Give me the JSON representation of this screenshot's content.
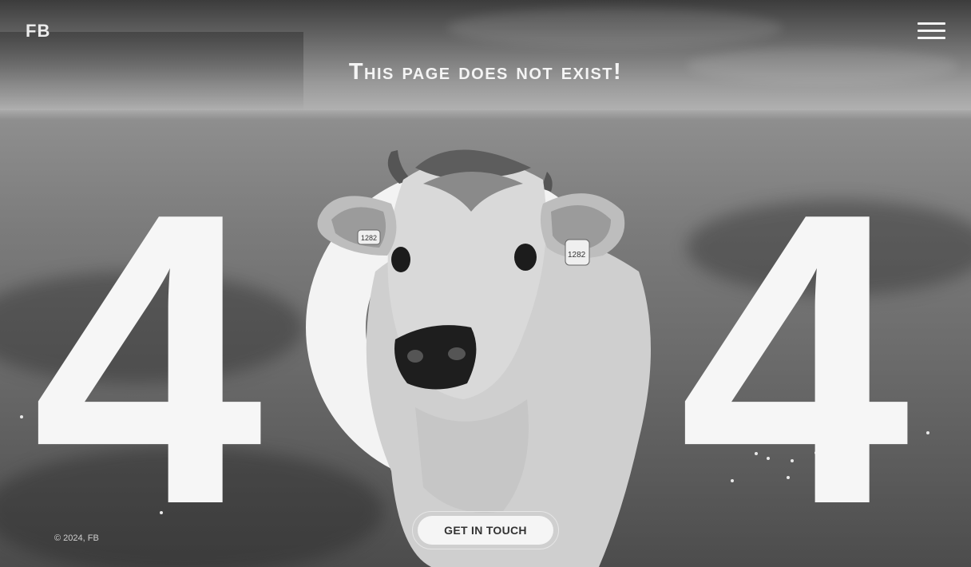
{
  "header": {
    "logo": "FB",
    "menu_icon": "hamburger-menu-icon"
  },
  "headline": "This page does not exist!",
  "error_code": {
    "digit_left": "4",
    "digit_middle": "0",
    "digit_right": "4"
  },
  "cta": {
    "label": "GET IN TOUCH"
  },
  "footer": {
    "copyright": "© 2024, FB"
  },
  "colors": {
    "text_light": "#f4f4f4",
    "button_bg": "#f5f5f5",
    "button_text": "#333333"
  }
}
